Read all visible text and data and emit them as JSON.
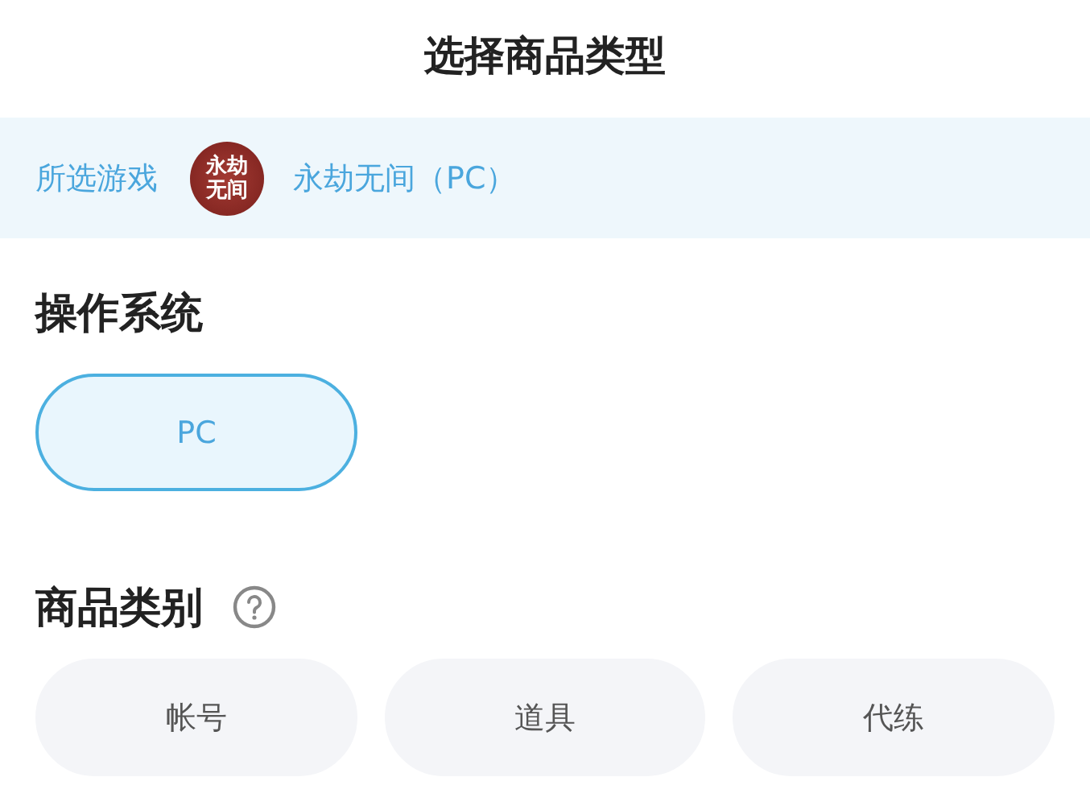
{
  "title": "选择商品类型",
  "game": {
    "label": "所选游戏",
    "icon_text": "永劫无间",
    "name": "永劫无间（PC）"
  },
  "sections": [
    {
      "heading": "操作系统",
      "help": false,
      "options": [
        {
          "label": "PC",
          "selected": true
        }
      ]
    },
    {
      "heading": "商品类别",
      "help": true,
      "options": [
        {
          "label": "帐号",
          "selected": false
        },
        {
          "label": "道具",
          "selected": false
        },
        {
          "label": "代练",
          "selected": false
        }
      ]
    }
  ]
}
